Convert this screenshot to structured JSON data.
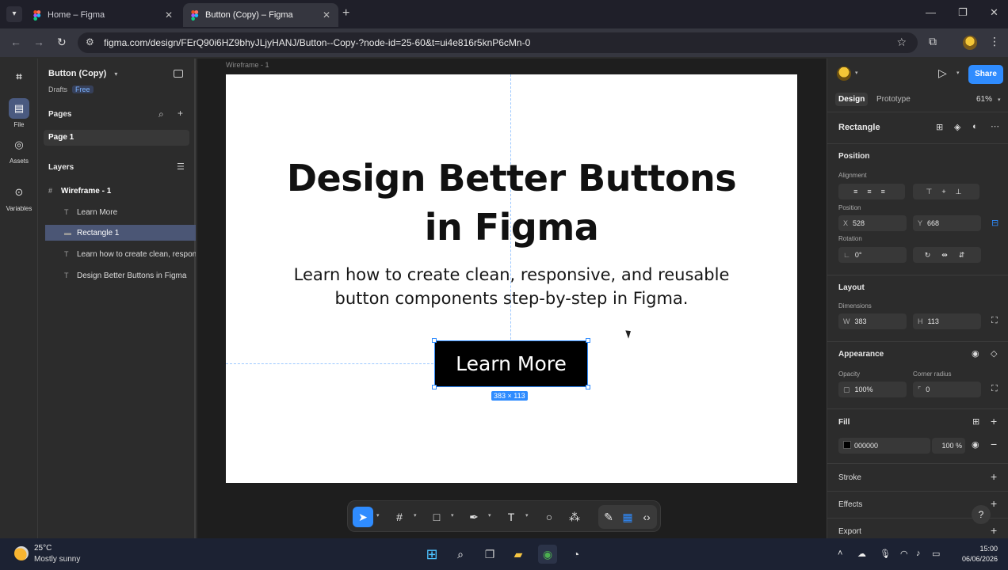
{
  "browser": {
    "tabs": [
      {
        "title": "Home – Figma",
        "active": false
      },
      {
        "title": "Button (Copy) – Figma",
        "active": true
      }
    ],
    "url": "figma.com/design/FErQ90i6HZ9bhyJLjyHANJ/Button--Copy-?node-id=25-60&t=ui4e816r5knP6cMn-0"
  },
  "rail": {
    "items": [
      {
        "label": "File",
        "icon": "file-icon"
      },
      {
        "label": "Assets",
        "icon": "assets-icon"
      },
      {
        "label": "Variables",
        "icon": "variables-icon"
      }
    ]
  },
  "left_panel": {
    "file_name": "Button (Copy)",
    "drafts": "Drafts",
    "plan_badge": "Free",
    "pages_heading": "Pages",
    "pages": [
      "Page 1"
    ],
    "layers_heading": "Layers",
    "layers": [
      {
        "name": "Wireframe - 1",
        "kind": "frame"
      },
      {
        "name": "Learn More",
        "kind": "text"
      },
      {
        "name": "Rectangle 1",
        "kind": "rectangle",
        "selected": true
      },
      {
        "name": "Learn how to create clean, responsive, and reusable button components step-by-step in Figma.",
        "kind": "text"
      },
      {
        "name": "Design Better Buttons in Figma",
        "kind": "text"
      }
    ]
  },
  "canvas": {
    "frame_label": "Wireframe - 1",
    "headline_line1": "Design Better Buttons",
    "headline_line2": "in Figma",
    "sub_line1": "Learn how to create clean, responsive, and reusable",
    "sub_line2": "button components step-by-step in Figma.",
    "button_label": "Learn More",
    "dimension_badge": "383 × 113"
  },
  "right_panel": {
    "share_label": "Share",
    "tabs": [
      "Design",
      "Prototype"
    ],
    "zoom": "61%",
    "selection_name": "Rectangle",
    "position_heading": "Position",
    "alignment_label": "Alignment",
    "position_label": "Position",
    "x_label": "X",
    "x_value": "528",
    "y_label": "Y",
    "y_value": "668",
    "rotation_label": "Rotation",
    "rotation_value": "0°",
    "layout_heading": "Layout",
    "dimensions_label": "Dimensions",
    "w_label": "W",
    "w_value": "383",
    "h_label": "H",
    "h_value": "113",
    "appearance_heading": "Appearance",
    "opacity_label": "Opacity",
    "opacity_value": "100%",
    "radius_label": "Corner radius",
    "radius_value": "0",
    "fill_heading": "Fill",
    "fill_hex": "000000",
    "fill_opacity": "100",
    "percent": "%",
    "stroke_heading": "Stroke",
    "effects_heading": "Effects",
    "export_heading": "Export",
    "help": "?"
  },
  "taskbar": {
    "temperature": "25°C",
    "weather": "Mostly sunny",
    "time": "15:00",
    "date": "06/06/2026"
  },
  "colors": {
    "accent": "#2f8cff",
    "button_fill": "#000000",
    "artboard": "#ffffff"
  }
}
